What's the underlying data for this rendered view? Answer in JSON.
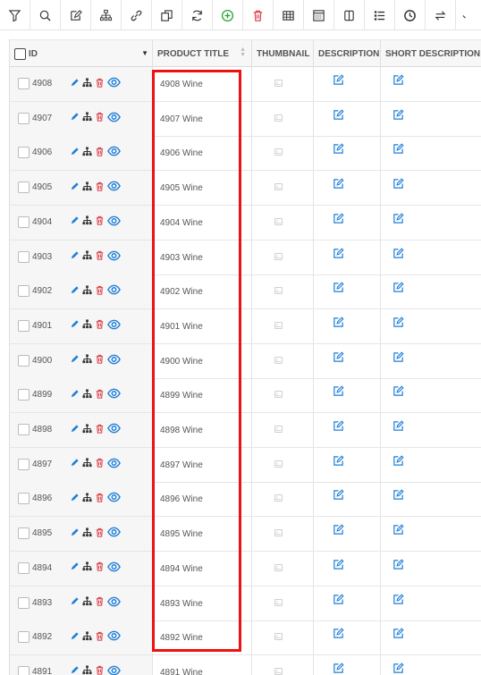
{
  "toolbar": {
    "icons": [
      "filter-icon",
      "search-icon",
      "edit-icon",
      "hierarchy-icon",
      "link-icon",
      "duplicate-icon",
      "refresh-icon",
      "add-circle-icon",
      "trash-icon",
      "table-icon",
      "spreadsheet-icon",
      "columns-icon",
      "list-icon",
      "clock-icon",
      "swap-icon",
      "more-icon"
    ],
    "colors": {
      "add": "#22a336",
      "delete": "#d9363e",
      "default": "#333333"
    }
  },
  "columns": {
    "id": "ID",
    "title": "PRODUCT TITLE",
    "thumbnail": "THUMBNAIL",
    "description": "DESCRIPTION",
    "short_description": "SHORT DESCRIPTION"
  },
  "rows": [
    {
      "id": "4908",
      "title": "4908 Wine"
    },
    {
      "id": "4907",
      "title": "4907 Wine"
    },
    {
      "id": "4906",
      "title": "4906 Wine"
    },
    {
      "id": "4905",
      "title": "4905 Wine"
    },
    {
      "id": "4904",
      "title": "4904 Wine"
    },
    {
      "id": "4903",
      "title": "4903 Wine"
    },
    {
      "id": "4902",
      "title": "4902 Wine"
    },
    {
      "id": "4901",
      "title": "4901 Wine"
    },
    {
      "id": "4900",
      "title": "4900 Wine"
    },
    {
      "id": "4899",
      "title": "4899 Wine"
    },
    {
      "id": "4898",
      "title": "4898 Wine"
    },
    {
      "id": "4897",
      "title": "4897 Wine"
    },
    {
      "id": "4896",
      "title": "4896 Wine"
    },
    {
      "id": "4895",
      "title": "4895 Wine"
    },
    {
      "id": "4894",
      "title": "4894 Wine"
    },
    {
      "id": "4893",
      "title": "4893 Wine"
    },
    {
      "id": "4892",
      "title": "4892 Wine"
    },
    {
      "id": "4891",
      "title": "4891 Wine"
    }
  ],
  "colors": {
    "action_blue": "#1e7fd6",
    "action_dark": "#333333",
    "action_red": "#d9363e",
    "highlight": "#ee1111"
  }
}
